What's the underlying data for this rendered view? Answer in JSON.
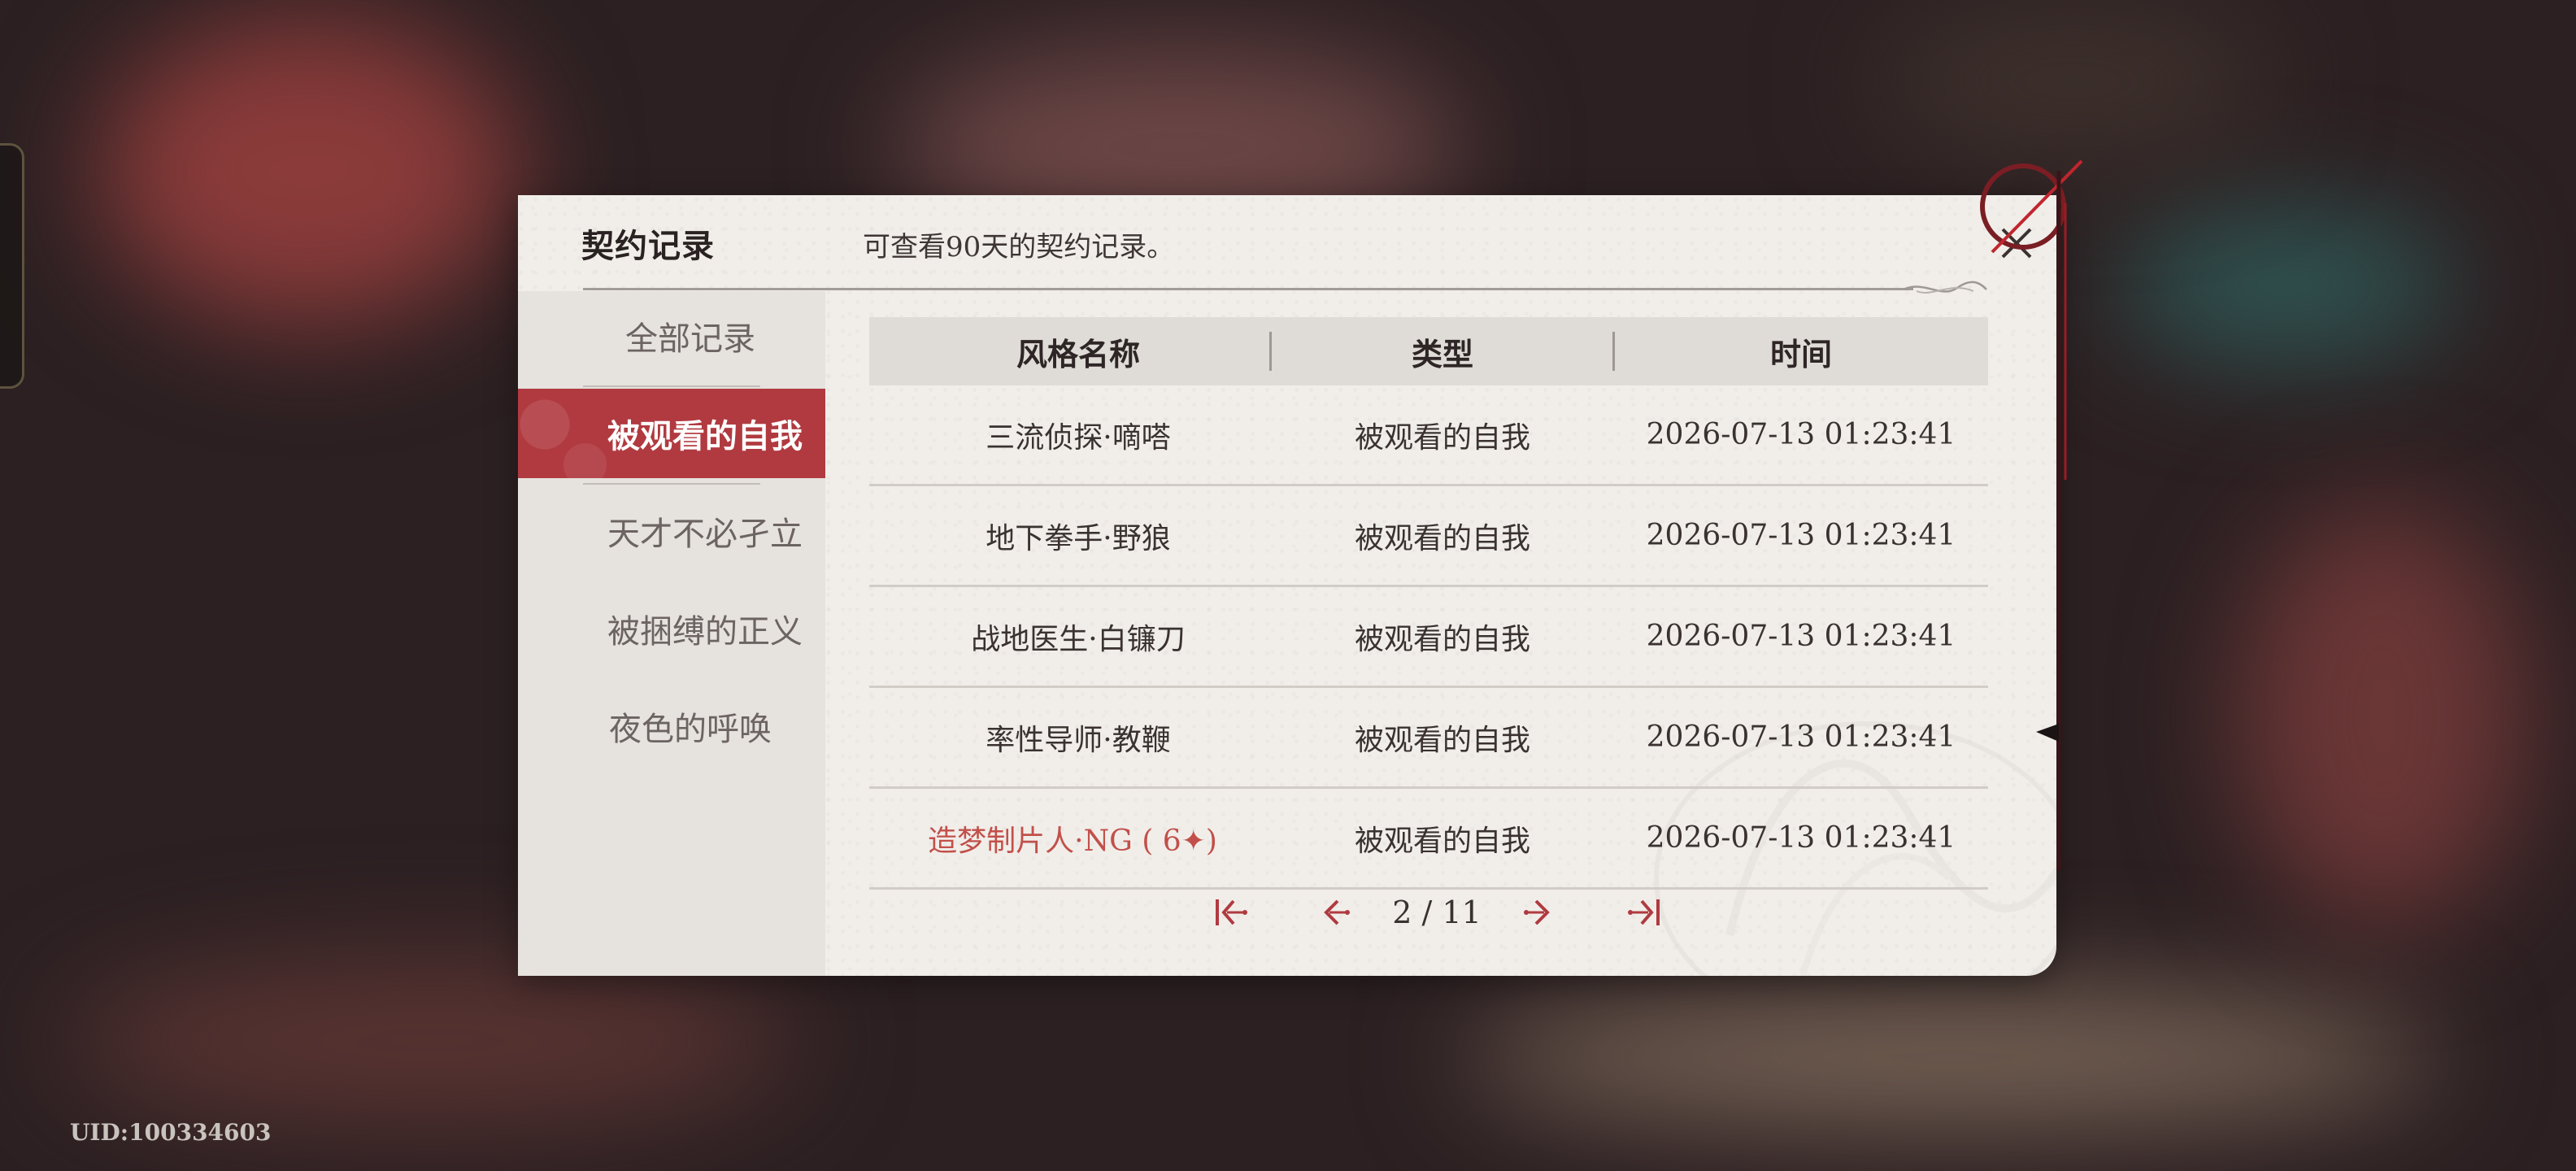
{
  "dialog": {
    "title": "契约记录",
    "subtitle": "可查看90天的契约记录。"
  },
  "sidebar": {
    "items": [
      {
        "label": "全部记录",
        "active": false
      },
      {
        "label": "被观看的自我",
        "active": true
      },
      {
        "label": "天才不必孑立",
        "active": false
      },
      {
        "label": "被捆缚的正义",
        "active": false
      },
      {
        "label": "夜色的呼唤",
        "active": false
      }
    ]
  },
  "table": {
    "columns": [
      "风格名称",
      "类型",
      "时间"
    ],
    "rows": [
      {
        "name": "三流侦探·嘀嗒",
        "type": "被观看的自我",
        "time": "2026-07-13 01:23:41",
        "highlight": false
      },
      {
        "name": "地下拳手·野狼",
        "type": "被观看的自我",
        "time": "2026-07-13 01:23:41",
        "highlight": false
      },
      {
        "name": "战地医生·白镰刀",
        "type": "被观看的自我",
        "time": "2026-07-13 01:23:41",
        "highlight": false
      },
      {
        "name": "率性导师·教鞭",
        "type": "被观看的自我",
        "time": "2026-07-13 01:23:41",
        "highlight": false
      },
      {
        "name": "造梦制片人·NG ( 6✦)",
        "type": "被观看的自我",
        "time": "2026-07-13 01:23:41",
        "highlight": true
      }
    ]
  },
  "pager": {
    "text": "2 / 11",
    "current": 2,
    "total": 11
  },
  "footer": {
    "uid": "UID:100334603"
  },
  "colors": {
    "accent": "#b03a40",
    "highlight_text": "#c2504a",
    "panel": "#f1eeea",
    "sidebar": "#e6e2dd"
  }
}
